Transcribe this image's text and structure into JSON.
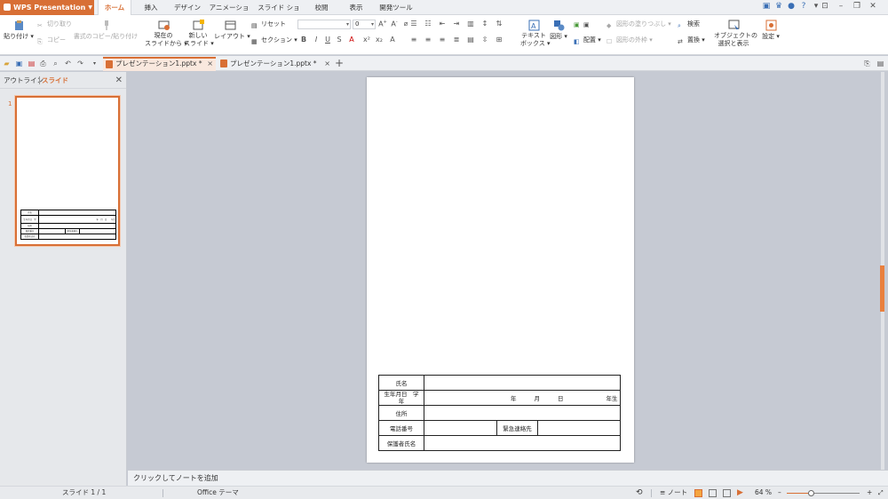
{
  "app": {
    "name": "WPS Presentation"
  },
  "ribbon_tabs": [
    {
      "label": "ホーム",
      "active": true
    },
    {
      "label": "挿入"
    },
    {
      "label": "デザイン"
    },
    {
      "label": "アニメーション"
    },
    {
      "label": "スライド ショー"
    },
    {
      "label": "校閲"
    },
    {
      "label": "表示"
    },
    {
      "label": "開発ツール"
    }
  ],
  "ribbon": {
    "paste": "貼り付け",
    "cut": "切り取り",
    "copy": "コピー",
    "format_painter": "書式のコピー/貼り付け",
    "from_current_line1": "現在の",
    "from_current_line2": "スライドから",
    "new_slide_line1": "新しい",
    "new_slide_line2": "スライド",
    "layout": "レイアウト",
    "reset": "リセット",
    "section": "セクション",
    "font_name_value": "",
    "font_size_value": "0",
    "textbox_line1": "テキスト",
    "textbox_line2": "ボックス",
    "shapes": "図形",
    "arrange": "配置",
    "shape_fill": "図形の塗りつぶし",
    "shape_outline": "図形の外枠",
    "find": "検索",
    "replace": "置換",
    "select_pane_line1": "オブジェクトの",
    "select_pane_line2": "選択と表示",
    "settings": "設定"
  },
  "doc_tabs": [
    {
      "title": "プレゼンテーション1.pptx *",
      "active": true
    },
    {
      "title": "プレゼンテーション1.pptx *",
      "active": false
    }
  ],
  "left_pane": {
    "tab_outline": "アウトライン",
    "tab_slides": "スライド",
    "slide_number": "1"
  },
  "form": {
    "name_label": "氏名",
    "birth_label_line1": "生年月日　学",
    "birth_label_line2": "年",
    "year": "年",
    "month": "月",
    "day": "日",
    "grade": "年生",
    "address_label": "住所",
    "phone_label": "電話番号",
    "emergency_label": "緊急連絡先",
    "guardian_label": "保護者氏名"
  },
  "notes_placeholder": "クリックしてノートを追加",
  "status": {
    "slide_indicator": "スライド 1 / 1",
    "theme": "Office テーマ",
    "notes_label": "ノート",
    "zoom": "64 %",
    "zoom_fraction": 0.34
  },
  "colors": {
    "accent": "#d86f35",
    "canvas": "#c6cad3"
  }
}
